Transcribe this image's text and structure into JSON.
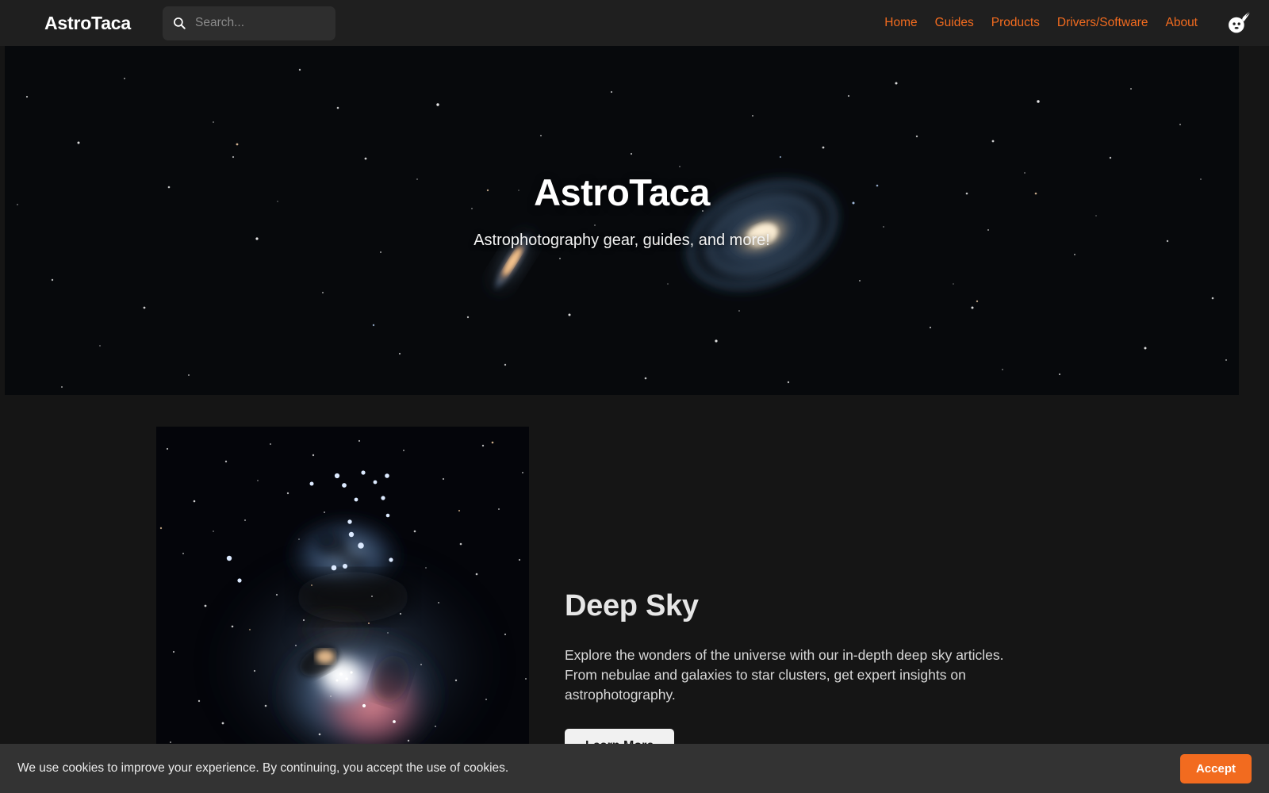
{
  "header": {
    "brand": "AstroTaca",
    "search": {
      "value": "",
      "placeholder": "Search..."
    },
    "search_icon": "search-icon",
    "logo_icon": "comet-logo-icon",
    "nav": [
      {
        "label": "Home"
      },
      {
        "label": "Guides"
      },
      {
        "label": "Products"
      },
      {
        "label": "Drivers/Software"
      },
      {
        "label": "About"
      }
    ]
  },
  "hero": {
    "title": "AstroTaca",
    "subtitle": "Astrophotography gear, guides, and more!"
  },
  "feature": {
    "title": "Deep Sky",
    "body": "Explore the wonders of the universe with our in-depth deep sky articles. From nebulae and galaxies to star clusters, get expert insights on astrophotography.",
    "button": "Learn More"
  },
  "cookie": {
    "message": "We use cookies to improve your experience. By continuing, you accept the use of cookies.",
    "accept": "Accept"
  },
  "colors": {
    "accent": "#f26b1f",
    "header_bg": "#1f1f1f",
    "page_bg": "#151515",
    "cookie_bg": "#333333",
    "nav_link": "#f26b1f",
    "heading": "#e6e6e6"
  }
}
